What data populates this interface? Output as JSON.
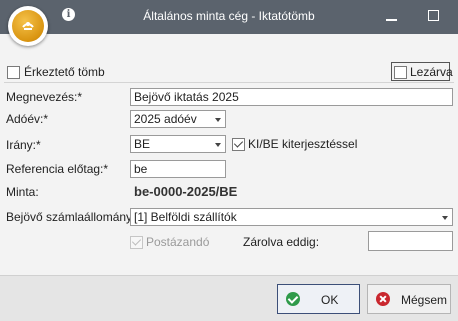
{
  "window": {
    "title": "Általános minta cég - Iktatótömb",
    "logo_icon": "app-logo-icon",
    "info_icon": "info-icon"
  },
  "form": {
    "erkezteto_label": "Érkeztető tömb",
    "erkezteto_checked": false,
    "lezarva_label": "Lezárva",
    "lezarva_checked": false,
    "megnevezes_label": "Megnevezés:*",
    "megnevezes_value": "Bejövő iktatás 2025",
    "adoev_label": "Adóév:*",
    "adoev_value": "2025 adóév",
    "irany_label": "Irány:*",
    "irany_value": "BE",
    "kibe_label": "KI/BE kiterjesztéssel",
    "kibe_checked": true,
    "referencia_label": "Referencia előtag:*",
    "referencia_value": "be",
    "minta_label": "Minta:",
    "minta_value": "be-0000-2025/BE",
    "szamlaallomany_label": "Bejövő számlaállomány:",
    "szamlaallomany_value": "[1] Belföldi szállítók",
    "postazando_label": "Postázandó",
    "postazando_checked": true,
    "zarolva_label": "Zárolva eddig:",
    "zarolva_value": ""
  },
  "footer": {
    "ok_label": "OK",
    "cancel_label": "Mégsem"
  },
  "colors": {
    "titlebar": "#5b636d",
    "ok_icon": "#2f9a4a",
    "cancel_icon": "#c9272e"
  }
}
